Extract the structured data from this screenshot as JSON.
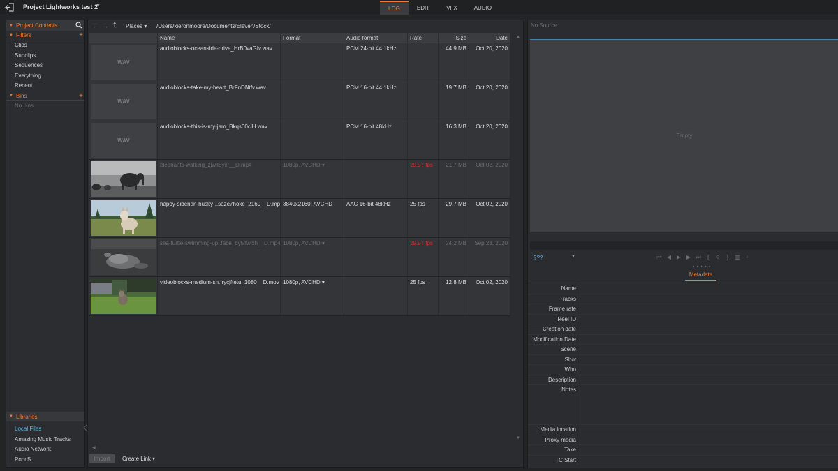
{
  "topbar": {
    "project_title": "Project Lightworks test 2",
    "tabs": [
      {
        "label": "LOG",
        "active": true
      },
      {
        "label": "EDIT",
        "active": false
      },
      {
        "label": "VFX",
        "active": false
      },
      {
        "label": "AUDIO",
        "active": false
      }
    ]
  },
  "sidebar": {
    "header": "Project Contents",
    "filters_label": "Filters",
    "filters": [
      "Clips",
      "Subclips",
      "Sequences",
      "Everything",
      "Recent"
    ],
    "bins_label": "Bins",
    "no_bins": "No bins",
    "libraries_label": "Libraries",
    "libraries": [
      "Local Files",
      "Amazing Music Tracks",
      "Audio Network",
      "Pond5"
    ],
    "selected_library": "Local Files"
  },
  "browser": {
    "places_label": "Places",
    "path": "/Users/kieronmoore/Documents/Eleven/Stock/",
    "columns": [
      "Name",
      "Format",
      "Audio format",
      "Rate",
      "Size",
      "Date"
    ],
    "rows": [
      {
        "thumb": "WAV",
        "name": "audioblocks-oceanside-drive_HrB0vaGIv.wav",
        "format": "",
        "audio": "PCM 24-bit 44.1kHz",
        "rate": "",
        "size": "44.9 MB",
        "date": "Oct 20, 2020",
        "dim": false
      },
      {
        "thumb": "WAV",
        "name": "audioblocks-take-my-heart_BrFnDNtfv.wav",
        "format": "",
        "audio": "PCM 16-bit 44.1kHz",
        "rate": "",
        "size": "19.7 MB",
        "date": "Oct 20, 2020",
        "dim": false
      },
      {
        "thumb": "WAV",
        "name": "audioblocks-this-is-my-jam_Bkqs00clH.wav",
        "format": "",
        "audio": "PCM 16-bit 48kHz",
        "rate": "",
        "size": "16.3 MB",
        "date": "Oct 20, 2020",
        "dim": false
      },
      {
        "thumb": "elephants",
        "name": "elephants-walking_zjwit8yxr__D.mp4",
        "format": "1080p, AVCHD",
        "audio": "",
        "rate": "29.97 fps",
        "size": "21.7 MB",
        "date": "Oct 02, 2020",
        "dim": true
      },
      {
        "thumb": "husky",
        "name": "happy-siberian-husky-..saze7hoke_2160__D.mp4",
        "format": "3840x2160, AVCHD",
        "audio": "AAC 16-bit 48kHz",
        "rate": "25 fps",
        "size": "29.7 MB",
        "date": "Oct 02, 2020",
        "dim": false
      },
      {
        "thumb": "turtle",
        "name": "sea-turtle-swimming-up..face_by5lfwixh__D.mp4",
        "format": "1080p, AVCHD",
        "audio": "",
        "rate": "29.97 fps",
        "size": "24.2 MB",
        "date": "Sep 23, 2020",
        "dim": true
      },
      {
        "thumb": "cat",
        "name": "videoblocks-medium-sh..rycjftetu_1080__D.mov",
        "format": "1080p, AVCHD",
        "audio": "",
        "rate": "25 fps",
        "size": "12.8 MB",
        "date": "Oct 02, 2020",
        "dim": false
      }
    ],
    "import_label": "Import",
    "create_link_label": "Create Link"
  },
  "viewer": {
    "source_label": "No Source",
    "empty_label": "Empty",
    "track_select": "???",
    "metadata_tab": "Metadata",
    "metadata_fields": [
      "Name",
      "Tracks",
      "Frame rate",
      "Reel ID",
      "Creation date",
      "Modification Date",
      "Scene",
      "Shot",
      "Who",
      "Description",
      "Notes",
      "Media location",
      "Proxy media",
      "Take",
      "TC Start"
    ]
  },
  "colors": {
    "accent": "#f07a2c",
    "selection": "#5fb5e8",
    "warning": "#c8322a"
  }
}
